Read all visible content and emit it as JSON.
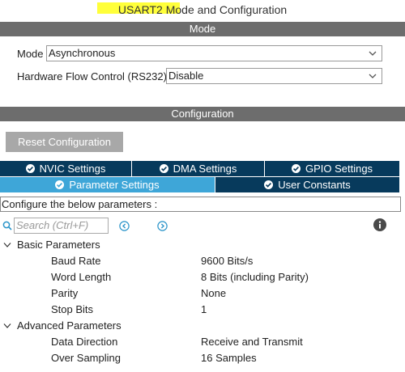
{
  "title": "USART2 Mode and Configuration",
  "mode_section": {
    "header": "Mode",
    "mode_label": "Mode",
    "mode_value": "Asynchronous",
    "flow_label": "Hardware Flow Control (RS232)",
    "flow_value": "Disable"
  },
  "config_section": {
    "header": "Configuration",
    "reset_button": "Reset Configuration",
    "tabs_row1": [
      "NVIC Settings",
      "DMA Settings",
      "GPIO Settings"
    ],
    "tabs_row2": [
      "Parameter Settings",
      "User Constants"
    ],
    "hint": "Configure the below parameters :",
    "search_placeholder": "Search (Ctrl+F)"
  },
  "tree": {
    "groups": [
      {
        "label": "Basic Parameters",
        "params": [
          {
            "name": "Baud Rate",
            "value": "9600 Bits/s"
          },
          {
            "name": "Word Length",
            "value": "8 Bits (including Parity)"
          },
          {
            "name": "Parity",
            "value": "None"
          },
          {
            "name": "Stop Bits",
            "value": "1"
          }
        ]
      },
      {
        "label": "Advanced Parameters",
        "params": [
          {
            "name": "Data Direction",
            "value": "Receive and Transmit"
          },
          {
            "name": "Over Sampling",
            "value": "16 Samples"
          }
        ]
      }
    ]
  },
  "colors": {
    "section_bar": "#6d6d6d",
    "tab_dark": "#073a5c",
    "tab_active": "#3ea6d8",
    "highlight": "#ffff3a",
    "accent_icon": "#2a94c9"
  },
  "icons": {
    "dropdown": "chevron-down-icon",
    "tab_check": "check-circle-icon",
    "search": "search-icon",
    "prev": "previous-match-icon",
    "next": "next-match-icon",
    "info": "info-icon",
    "expand": "chevron-down-icon"
  }
}
